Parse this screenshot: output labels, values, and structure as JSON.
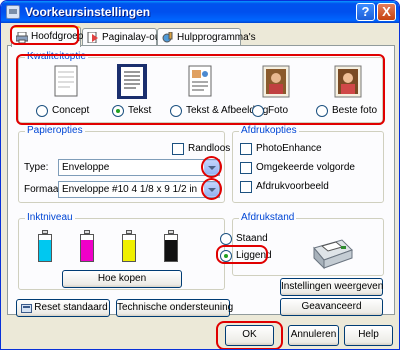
{
  "window": {
    "title": "Voorkeursinstellingen"
  },
  "titlebar": {
    "help": "?",
    "close": "X"
  },
  "tabs": [
    {
      "label": "Hoofdgroep"
    },
    {
      "label": "Paginalay-out"
    },
    {
      "label": "Hulpprogramma's"
    }
  ],
  "quality": {
    "title": "Kwaliteitoptie",
    "options": [
      {
        "label": "Concept",
        "checked": false
      },
      {
        "label": "Tekst",
        "checked": true
      },
      {
        "label": "Tekst & Afbeelding",
        "checked": false
      },
      {
        "label": "Foto",
        "checked": false
      },
      {
        "label": "Beste foto",
        "checked": false
      }
    ]
  },
  "paper": {
    "title": "Papieropties",
    "borderless_label": "Randloos",
    "type_label": "Type:",
    "type_value": "Enveloppe",
    "format_label": "Formaat:",
    "format_value": "Enveloppe #10 4 1/8 x 9 1/2 in"
  },
  "print_options": {
    "title": "Afdrukopties",
    "items": [
      {
        "label": "PhotoEnhance",
        "checked": false
      },
      {
        "label": "Omgekeerde volgorde",
        "checked": false
      },
      {
        "label": "Afdrukvoorbeeld",
        "checked": false
      }
    ]
  },
  "ink": {
    "title": "Inktniveau",
    "levels": [
      {
        "name": "cyan",
        "color": "#00c8f0",
        "level": 0.8
      },
      {
        "name": "magenta",
        "color": "#f000c8",
        "level": 0.8
      },
      {
        "name": "yellow",
        "color": "#f0f000",
        "level": 0.8
      },
      {
        "name": "black",
        "color": "#111111",
        "level": 0.8
      }
    ],
    "buy_button": "Hoe kopen"
  },
  "orientation": {
    "title": "Afdrukstand",
    "options": [
      {
        "label": "Staand",
        "checked": false
      },
      {
        "label": "Liggend",
        "checked": true
      }
    ]
  },
  "buttons": {
    "show_settings": "Instellingen weergeven",
    "advanced": "Geavanceerd",
    "reset": "Reset standaard",
    "support": "Technische ondersteuning",
    "ok": "OK",
    "cancel": "Annuleren",
    "help": "Help"
  },
  "colors": {
    "accent": "#0046d5",
    "highlight": "#e00000",
    "titlebar": "#0054e3"
  }
}
